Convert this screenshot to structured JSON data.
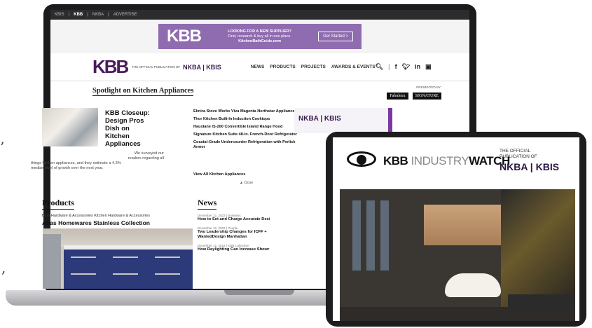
{
  "laptop_site": {
    "top_strip": [
      "KBIS",
      "KBB",
      "NKBA",
      "ADVERTISE"
    ],
    "ad_banner": {
      "logo": "KBB",
      "text_lines": [
        "LOOKING FOR A NEW SUPPLIER?",
        "Find, research & buy all in one place.",
        "KitchenBathGuide.com"
      ],
      "button": "Get Started >"
    },
    "nav": {
      "brand": "KBB",
      "publication": "THE OFFICIAL PUBLICATION OF",
      "partner": "NKBA | KBIS",
      "links": [
        "NEWS",
        "PRODUCTS",
        "PROJECTS",
        "AWARDS & EVENTS"
      ],
      "icons": [
        "search-icon",
        "facebook-icon",
        "twitter-icon",
        "linkedin-icon",
        "instagram-icon"
      ]
    },
    "spotlight": {
      "title": "Spotlight on Kitchen Appliances",
      "presented_by": "PRESENTED BY:",
      "sponsors": [
        "Fabuleux",
        "SIGNATURE"
      ]
    },
    "feature": {
      "title": "KBB Closeup: Design Pros Dish on Kitchen Appliances",
      "description_lines": [
        "We surveyed our",
        "readers regarding all",
        "things kitchen appliances, and they estimate a 4.3%",
        "median level of growth over the next year."
      ],
      "list": [
        "Elmira Stove Works Viva Magenta Northstar Appliances",
        "Thor Kitchen Built-In Induction Cooktops",
        "Hauslane IS-200 Convertible Island Range Hood",
        "Signature Kitchen Suite 48-in. French-Door Refrigerator",
        "Coastal-Grade Undercounter Refrigeration with Perlick Armor"
      ],
      "view_all": "View All Kitchen Appliances",
      "close": "▲ Close"
    },
    "side_ad": "NKBA | KBIS",
    "products": {
      "heading": "Products",
      "category": "Bath Hardware & Accessories Kitchen Hardware & Accessories",
      "title": "Atlas Homewares Stainless Collection"
    },
    "news": {
      "heading": "News",
      "items": [
        {
          "meta": "December 12, 2022 | Business",
          "title": "How to Set and Charge Accurate Desi"
        },
        {
          "meta": "December 12, 2022 | People",
          "title": "Two Leadership Changes for ICFF + WantedDesign Manhattan"
        },
        {
          "meta": "December 12, 2022 | KBB Collective",
          "title": "How Daylighting Can Increase Showr"
        }
      ]
    }
  },
  "tablet_site": {
    "logo_word": "KBB",
    "logo_thin": "INDUSTRY",
    "logo_bold": "WATCH",
    "publication_lines": [
      "THE OFFICIAL",
      "PUBLICATION OF"
    ],
    "partner": "NKBA | KBIS"
  },
  "edge_marks": [
    "’",
    ","
  ]
}
